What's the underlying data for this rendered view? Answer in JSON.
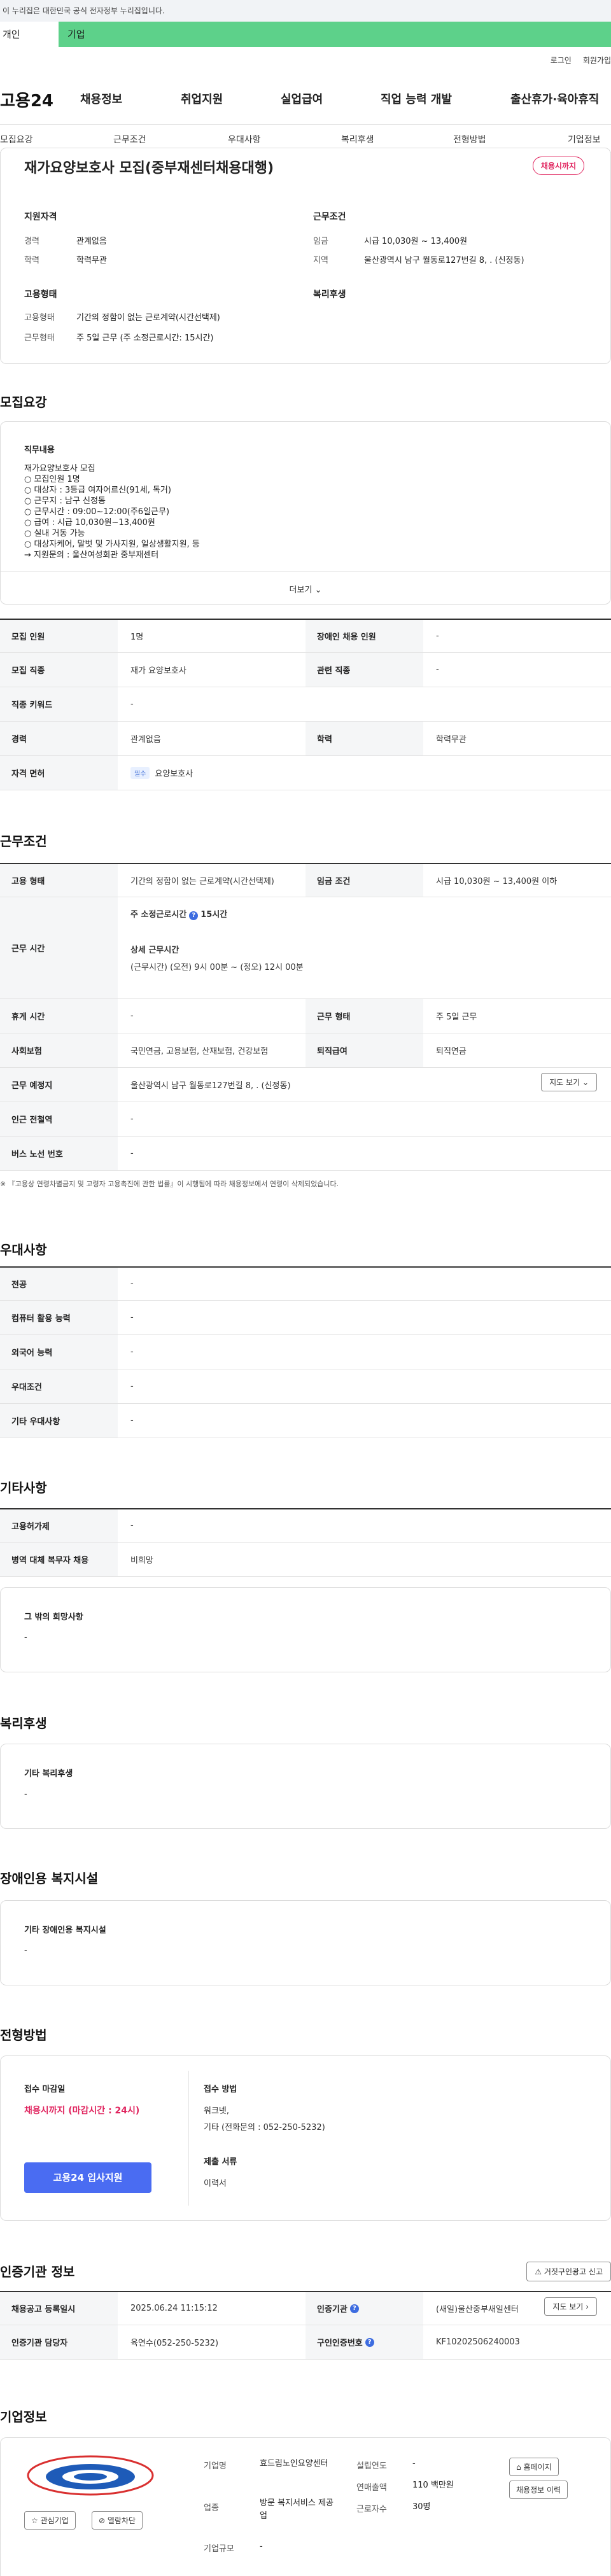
{
  "gov_banner": "이 누리집은 대한민국 공식 전자정부 누리집입니다.",
  "user_tabs": {
    "personal": "개인",
    "corp": "기업"
  },
  "util_links": [
    "로그인",
    "회원가입"
  ],
  "logo": "고용24",
  "gnb": [
    "채용정보",
    "취업지원",
    "실업급여",
    "직업 능력 개발",
    "출산휴가·육아휴직"
  ],
  "subnav": [
    "모집요강",
    "근무조건",
    "우대사항",
    "복리후생",
    "전형방법",
    "기업정보"
  ],
  "job": {
    "title": "재가요양보호사 모집(중부재센터채용대행)",
    "status": "채용시까지",
    "left": {
      "qual_head": "지원자격",
      "career_label": "경력",
      "career": "관계없음",
      "edu_label": "학력",
      "edu": "학력무관",
      "type_head": "고용형태",
      "emp_label": "고용형태",
      "emp": "기간의 정함이 없는 근로계약(시간선택제)",
      "work_label": "근무형태",
      "work": "주 5일 근무 (주 소정근로시간: 15시간)"
    },
    "right": {
      "cond_head": "근무조건",
      "wage_label": "임금",
      "wage": "시급 10,030원 ~ 13,400원",
      "region_label": "지역",
      "region": "울산광역시 남구 월동로127번길 8, . (신정동)",
      "welfare_head": "복리후생"
    }
  },
  "recruit": {
    "title": "모집요강",
    "content_label": "직무내용",
    "content_lines": [
      "재가요양보호사 모집",
      "○ 모집인원 1명",
      "○ 대상자 : 3등급 여자어르신(91세, 독거)",
      "○ 근무지 : 남구 신정동",
      "○ 근무시간 : 09:00~12:00(주6일근무)",
      "○ 급여 : 시급 10,030원~13,400원",
      "○ 실내 거동 가능",
      "○ 대상자케어, 말벗 및 가사지원, 일상생활지원, 등",
      "→ 지원문의 : 울산여성회관 중부재센터"
    ],
    "more": "더보기",
    "table": {
      "count_label": "모집 인원",
      "count": "1명",
      "disabled_label": "장애인 채용 인원",
      "disabled": "-",
      "job_label": "모집 직종",
      "job": "재가 요양보호사",
      "related_label": "관련 직종",
      "related": "-",
      "keyword_label": "직종 키워드",
      "keyword": "-",
      "career_label": "경력",
      "career": "관계없음",
      "edu_label": "학력",
      "edu": "학력무관",
      "license_label": "자격 면허",
      "license_tag": "필수",
      "license": "요양보호사"
    }
  },
  "conditions": {
    "title": "근무조건",
    "emp_label": "고용 형태",
    "emp": "기간의 정함이 없는 근로계약(시간선택제)",
    "wage_label": "임금 조건",
    "wage": "시급 10,030원 ~ 13,400원 이하",
    "hours_label": "근무 시간",
    "hours_week": "주 소정근로시간",
    "hours_week_val": "15시간",
    "hours_detail_head": "상세 근무시간",
    "hours_detail": "(근무시간) (오전) 9시 00분 ~ (정오) 12시 00분",
    "rest_label": "휴게 시간",
    "rest": "-",
    "worktype_label": "근무 형태",
    "worktype": "주 5일 근무",
    "insurance_label": "사회보험",
    "insurance": "국민연금, 고용보험, 산재보험, 건강보험",
    "retire_label": "퇴직급여",
    "retire": "퇴직연금",
    "place_label": "근무 예정지",
    "place": "울산광역시 남구 월동로127번길 8, . (신정동)",
    "map_btn": "지도 보기",
    "station_label": "인근 전철역",
    "station": "-",
    "bus_label": "버스 노선 번호",
    "bus": "-",
    "note": "※ 『고용상 연령차별금지 및 고령자 고용촉진에 관한 법률』이 시행됨에 따라 채용정보에서 연령이 삭제되었습니다."
  },
  "preference": {
    "title": "우대사항",
    "major_label": "전공",
    "major": "-",
    "computer_label": "컴퓨터 활용 능력",
    "computer": "-",
    "language_label": "외국어 능력",
    "language": "-",
    "pref_label": "우대조건",
    "pref": "-",
    "etc_label": "기타 우대사항",
    "etc": "-"
  },
  "other": {
    "title": "기타사항",
    "equip_label": "고용허가제",
    "equip": "-",
    "military_label": "병역 대체 복무자 채용",
    "military": "비희망",
    "wish_label": "그 밖의 희망사항",
    "wish": "-"
  },
  "welfare": {
    "title": "복리후생",
    "etc_label": "기타 복리후생",
    "etc": "-"
  },
  "disability": {
    "title": "장애인용 복지시설",
    "label": "기타 장애인용 복지시설",
    "val": "-"
  },
  "selection": {
    "title": "전형방법",
    "deadline_label": "접수 마감일",
    "deadline": "채용시까지 (마감시간 : 24시)",
    "apply_btn": "고용24 입사지원",
    "method_label": "접수 방법",
    "method_lines": [
      "워크넷,",
      "기타 (전화문의 : 052-250-5232)"
    ],
    "docs_label": "제출 서류",
    "docs": "이력서"
  },
  "agency": {
    "title": "인증기관 정보",
    "report_btn": "거짓구인광고 신고",
    "date_label": "채용공고 등록일시",
    "date": "2025.06.24 11:15:12",
    "org_label": "인증기관",
    "org": "(새일)울산중부새일센터",
    "map_btn": "지도 보기",
    "manager_label": "인증기관 담당자",
    "manager": "육연수(052-250-5232)",
    "reg_label": "구인인증번호",
    "reg": "KF10202506240003"
  },
  "company": {
    "title": "기업정보",
    "interest_btn": "관심기업",
    "block_btn": "열람차단",
    "name_label": "기업명",
    "name": "효드림노인요양센터",
    "year_label": "설립연도",
    "year": "-",
    "industry_label": "업종",
    "industry": "방문 복지서비스 제공업",
    "sales_label": "연매출액",
    "sales": "110 백만원",
    "staff_label": "근로자수",
    "staff": "30명",
    "size_label": "기업규모",
    "size": "-",
    "homepage_btn": "홈페이지",
    "jobs_btn": "채용정보 이력"
  }
}
